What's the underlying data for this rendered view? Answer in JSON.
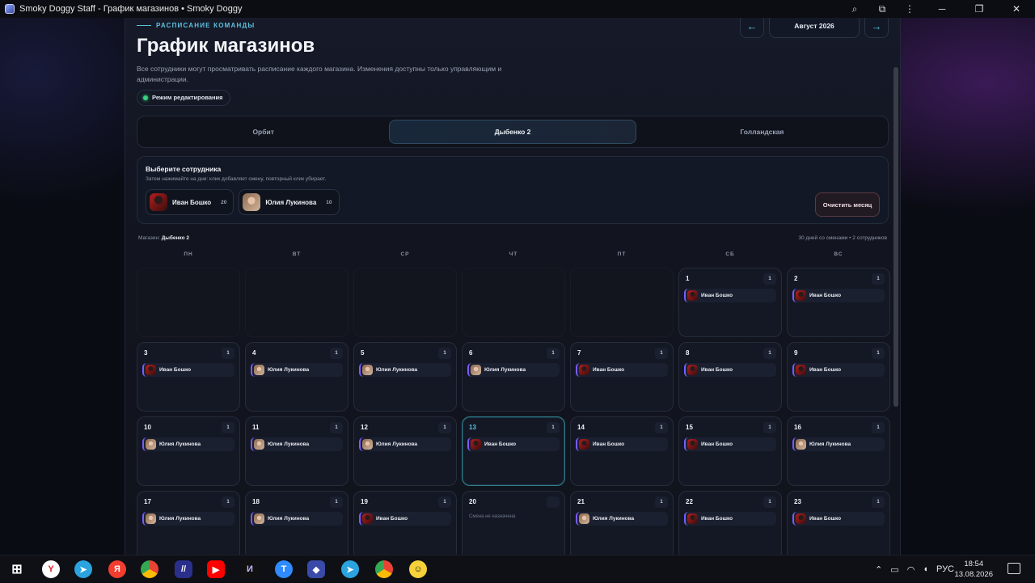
{
  "window": {
    "title": "Smoky Doggy Staff - График магазинов • Smoky Doggy",
    "icons": [
      "zoom-icon",
      "extensions-icon",
      "menu-icon",
      "minimize-icon",
      "maximize-icon",
      "close-icon"
    ]
  },
  "header": {
    "eyebrow": "РАСПИСАНИЕ КОМАНДЫ",
    "title": "График магазинов",
    "description": "Все сотрудники могут просматривать расписание каждого магазина. Изменения доступны только управляющим и администрации.",
    "edit_mode": "Режим редактирования",
    "prev_label": "←",
    "next_label": "→",
    "month_label": "Август 2026"
  },
  "tabs": [
    {
      "label": "Орбит",
      "active": false
    },
    {
      "label": "Дыбенко 2",
      "active": true
    },
    {
      "label": "Голландская",
      "active": false
    }
  ],
  "picker": {
    "title": "Выберите сотрудника",
    "hint": "Затем нажимайте на дни: клик добавляет смену, повторный клик убирает.",
    "employees": [
      {
        "name": "Иван Бошко",
        "count": "20",
        "avatar": "ivan"
      },
      {
        "name": "Юлия Лукинова",
        "count": "10",
        "avatar": "yulia"
      }
    ],
    "clear_label": "Очистить месяц"
  },
  "meta": {
    "store_prefix": "Магазин: ",
    "store_name": "Дыбенко 2",
    "summary": "30 дней со сменами • 2 сотрудников"
  },
  "weekdays": [
    "ПН",
    "ВТ",
    "СР",
    "ЧТ",
    "ПТ",
    "СБ",
    "ВС"
  ],
  "calendar": {
    "leading_empty": 5,
    "today": 13,
    "no_shift_text": "Смена не назначена",
    "days": [
      {
        "day": "1",
        "count": "1",
        "person": "Иван Бошко",
        "avatar": "ivan"
      },
      {
        "day": "2",
        "count": "1",
        "person": "Иван Бошко",
        "avatar": "ivan"
      },
      {
        "day": "3",
        "count": "1",
        "person": "Иван Бошко",
        "avatar": "ivan"
      },
      {
        "day": "4",
        "count": "1",
        "person": "Юлия Лукинова",
        "avatar": "yulia"
      },
      {
        "day": "5",
        "count": "1",
        "person": "Юлия Лукинова",
        "avatar": "yulia"
      },
      {
        "day": "6",
        "count": "1",
        "person": "Юлия Лукинова",
        "avatar": "yulia"
      },
      {
        "day": "7",
        "count": "1",
        "person": "Иван Бошко",
        "avatar": "ivan"
      },
      {
        "day": "8",
        "count": "1",
        "person": "Иван Бошко",
        "avatar": "ivan"
      },
      {
        "day": "9",
        "count": "1",
        "person": "Иван Бошко",
        "avatar": "ivan"
      },
      {
        "day": "10",
        "count": "1",
        "person": "Юлия Лукинова",
        "avatar": "yulia"
      },
      {
        "day": "11",
        "count": "1",
        "person": "Юлия Лукинова",
        "avatar": "yulia"
      },
      {
        "day": "12",
        "count": "1",
        "person": "Юлия Лукинова",
        "avatar": "yulia"
      },
      {
        "day": "13",
        "count": "1",
        "person": "Иван Бошко",
        "avatar": "ivan"
      },
      {
        "day": "14",
        "count": "1",
        "person": "Иван Бошко",
        "avatar": "ivan"
      },
      {
        "day": "15",
        "count": "1",
        "person": "Иван Бошко",
        "avatar": "ivan"
      },
      {
        "day": "16",
        "count": "1",
        "person": "Юлия Лукинова",
        "avatar": "yulia"
      },
      {
        "day": "17",
        "count": "1",
        "person": "Юлия Лукинова",
        "avatar": "yulia"
      },
      {
        "day": "18",
        "count": "1",
        "person": "Юлия Лукинова",
        "avatar": "yulia"
      },
      {
        "day": "19",
        "count": "1",
        "person": "Иван Бошко",
        "avatar": "ivan"
      },
      {
        "day": "20",
        "count": "",
        "person": "",
        "avatar": ""
      },
      {
        "day": "21",
        "count": "1",
        "person": "Юлия Лукинова",
        "avatar": "yulia"
      },
      {
        "day": "22",
        "count": "1",
        "person": "Иван Бошко",
        "avatar": "ivan"
      },
      {
        "day": "23",
        "count": "1",
        "person": "Иван Бошко",
        "avatar": "ivan"
      }
    ]
  },
  "taskbar": {
    "apps": [
      "windows-start-icon",
      "yandex-browser-icon",
      "telegram-icon",
      "yandex-icon",
      "chrome-icon",
      "app-icon",
      "youtube-icon",
      "ai-app-icon",
      "t-app-icon",
      "smoky-doggy-icon",
      "telegram-icon",
      "chrome-icon",
      "emoji-app-icon"
    ],
    "language": "РУС",
    "time": "18:54",
    "date": "13.08.2026"
  }
}
